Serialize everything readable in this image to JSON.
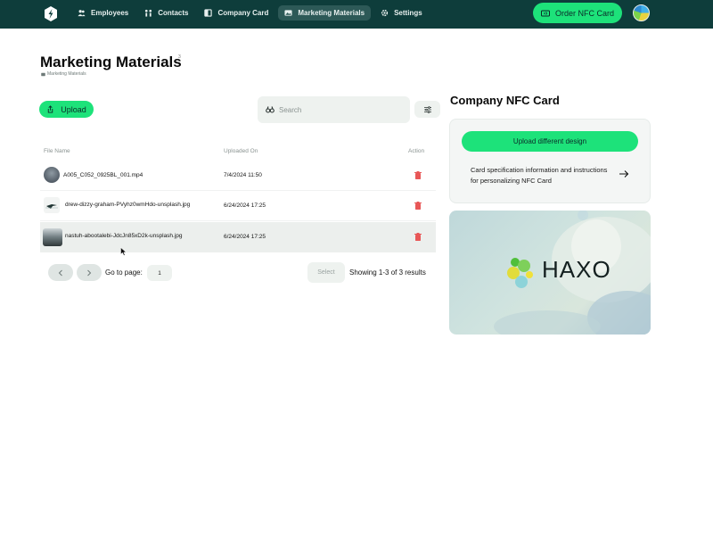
{
  "nav": {
    "items": [
      {
        "label": "Employees",
        "icon": "users-icon"
      },
      {
        "label": "Contacts",
        "icon": "contacts-icon"
      },
      {
        "label": "Company Card",
        "icon": "card-icon"
      },
      {
        "label": "Marketing Materials",
        "icon": "image-icon",
        "active": true
      },
      {
        "label": "Settings",
        "icon": "gear-icon"
      }
    ],
    "order_label": "Order NFC Card"
  },
  "page": {
    "title": "Marketing Materials",
    "count": "3",
    "breadcrumb": "Marketing Materials"
  },
  "toolbar": {
    "upload_label": "Upload",
    "search_placeholder": "Search"
  },
  "table": {
    "headers": {
      "file_name": "File Name",
      "uploaded_on": "Uploaded On",
      "action": "Action"
    },
    "rows": [
      {
        "name": "A005_C052_0925BL_001.mp4",
        "date": "7/4/2024 11:50"
      },
      {
        "name": "drew-dizzy-graham-PVyhz0wmHdo-unsplash.jpg",
        "date": "6/24/2024 17:25"
      },
      {
        "name": "nastuh-abootalebi-JdcJn85xD2k-unsplash.jpg",
        "date": "6/24/2024 17:25"
      }
    ]
  },
  "pagination": {
    "goto_label": "Go to page:",
    "page_value": "1",
    "select_label": "Select",
    "results_text": "Showing 1-3 of 3 results"
  },
  "nfc": {
    "title": "Company NFC Card",
    "upload_design_label": "Upload different design",
    "spec_text": "Card specification information and instructions for personalizing NFC Card",
    "brand": "HAXO"
  },
  "colors": {
    "topbar": "#0e3d3b",
    "accent": "#1de27a",
    "delete": "#e85757"
  }
}
